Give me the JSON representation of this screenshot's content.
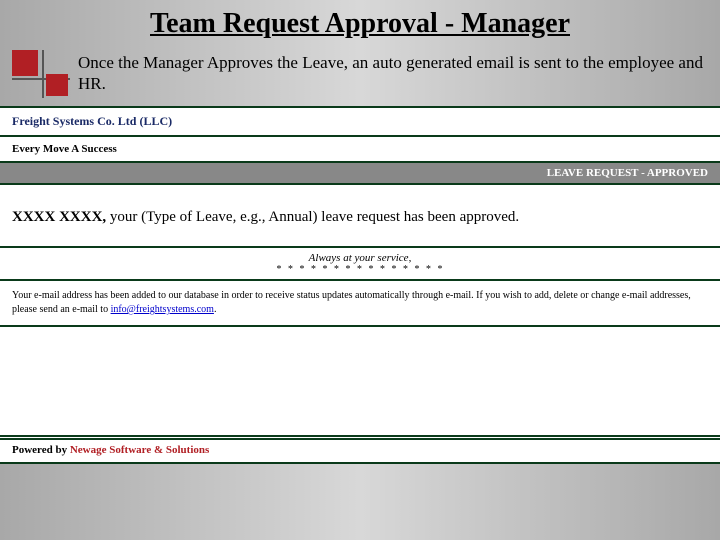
{
  "header": {
    "title": "Team Request Approval - Manager",
    "subtitle": "Once the Manager Approves the Leave, an auto generated email is sent to the employee and HR."
  },
  "email": {
    "company": "Freight Systems Co. Ltd (LLC)",
    "slogan": "Every Move A Success",
    "status": "LEAVE REQUEST - APPROVED",
    "recipient": "XXXX XXXX,",
    "body_text": " your (Type of Leave, e.g., Annual) leave request has been approved.",
    "signoff": "Always at your service,",
    "stars": "* * * * * * * * * * * * * * *",
    "db_note_pre": "Your e-mail address has been added to our database in order to receive status updates automatically through e-mail. If you wish to add, delete or change e-mail addresses, please send an e-mail to ",
    "db_note_link": "info@freightsystems.com",
    "db_note_post": ".",
    "powered_label": "Powered by ",
    "powered_vendor": "Newage Software & Solutions"
  }
}
